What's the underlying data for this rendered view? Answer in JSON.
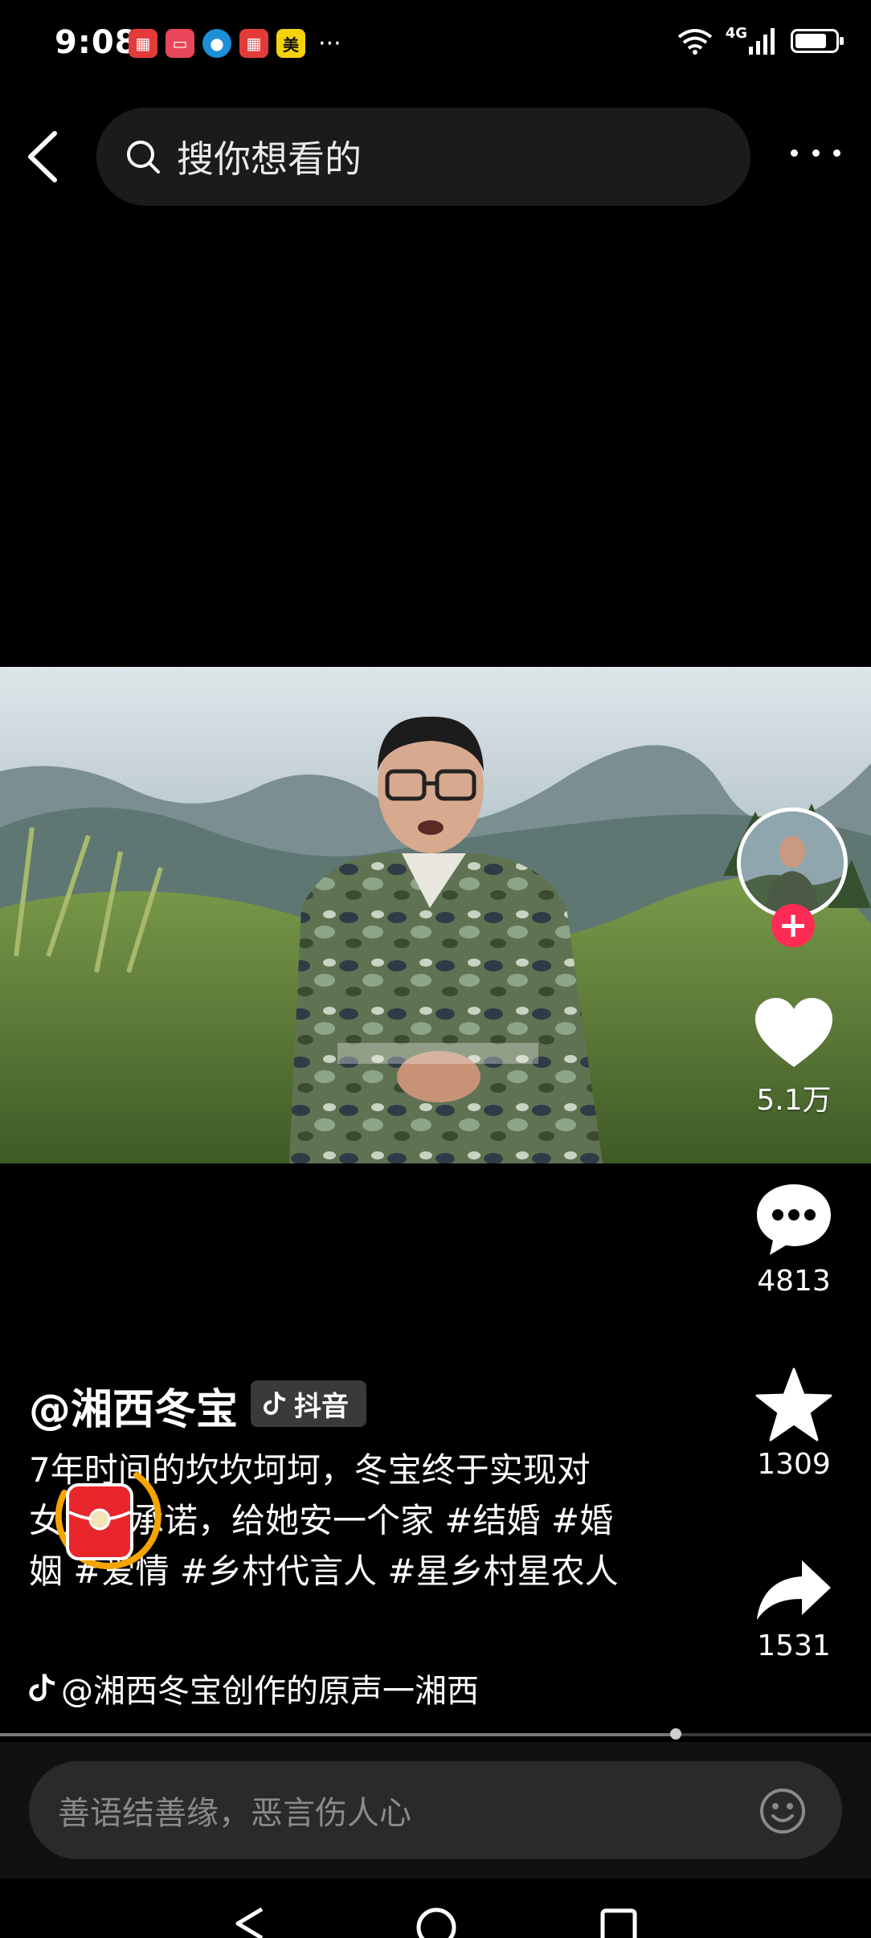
{
  "status_bar": {
    "time": "9:08",
    "notification_icons": [
      "app-icon-red",
      "app-icon-red-square",
      "app-icon-blue",
      "app-icon-red",
      "app-icon-yellow"
    ],
    "more_notifications": "···",
    "notification_labels": {
      "yellow": "美"
    },
    "network": "4G",
    "battery_level": 0.8
  },
  "header": {
    "search_placeholder": "搜你想看的"
  },
  "video": {
    "author_handle": "@湘西冬宝",
    "platform_label": "抖音",
    "caption": "7年时间的坎坎坷坷，冬宝终于实现对女儿的承诺，给她安一个家 #结婚 #婚姻 #爱情 #乡村代言人 #星乡村星农人",
    "music": "@湘西冬宝创作的原声一湘西",
    "progress": 0.776
  },
  "actions": {
    "likes": "5.1万",
    "comments": "4813",
    "favorites": "1309",
    "shares": "1531"
  },
  "comment_bar": {
    "placeholder": "善语结善缘，恶言伤人心"
  },
  "colors": {
    "accent_follow": "#fe2c55",
    "red_envelope": "#e8262c",
    "ring": "#f5a400"
  }
}
